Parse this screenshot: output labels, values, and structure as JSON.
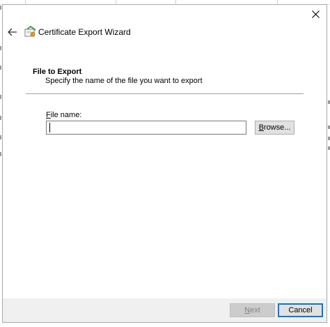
{
  "dialog": {
    "title": "Certificate Export Wizard",
    "icons": {
      "back": "back-arrow-icon",
      "close": "close-icon",
      "wizard": "certificate-icon"
    }
  },
  "section": {
    "heading": "File to Export",
    "description": "Specify the name of the file you want to export"
  },
  "file_field": {
    "label_accel": "F",
    "label_rest": "ile name:",
    "value": "",
    "placeholder": ""
  },
  "buttons": {
    "browse_accel": "",
    "browse_accel_char": "B",
    "browse_rest": "rowse...",
    "next_accel_char": "N",
    "next_rest": "ext",
    "next_enabled": false,
    "cancel": "Cancel"
  },
  "colors": {
    "accent": "#0078d7",
    "footer_bg": "#f0f0f0",
    "button_bg": "#e1e1e1",
    "disabled_text": "#838383"
  }
}
